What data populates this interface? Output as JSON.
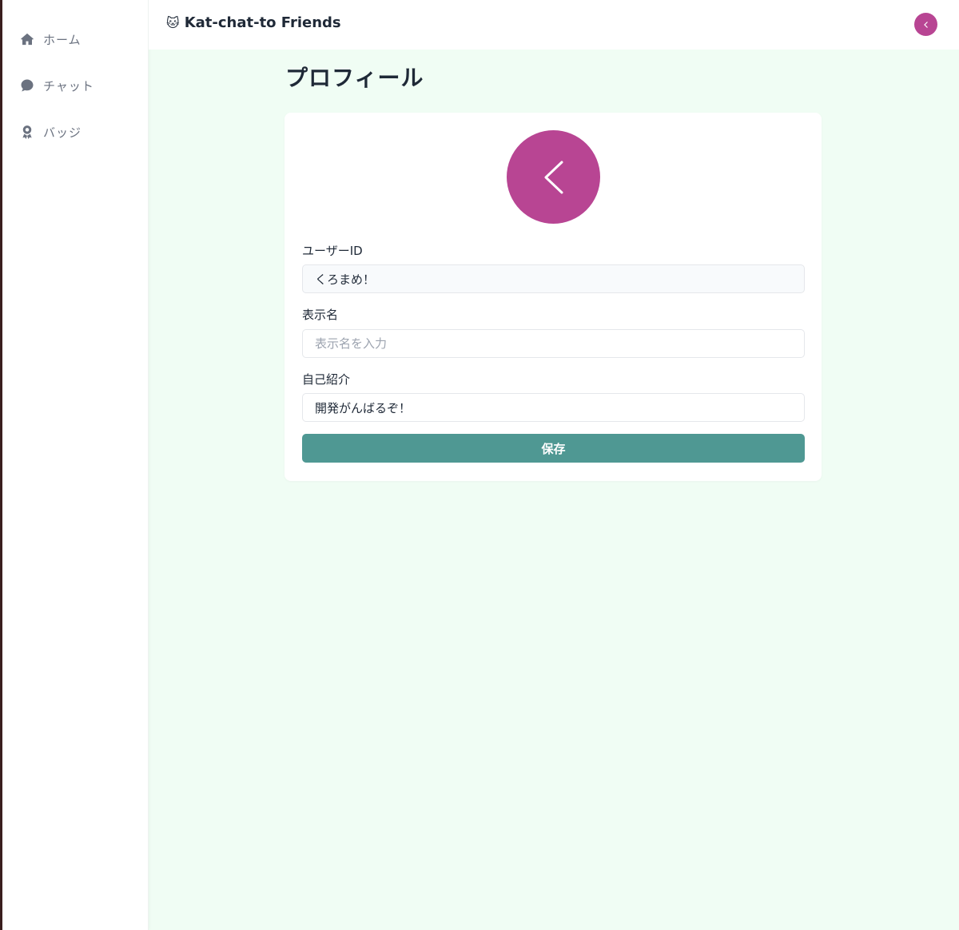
{
  "sidebar": {
    "items": [
      {
        "label": "ホーム",
        "icon": "home-icon"
      },
      {
        "label": "チャット",
        "icon": "chat-bubble-icon"
      },
      {
        "label": "バッジ",
        "icon": "badge-icon"
      }
    ]
  },
  "header": {
    "brand_emoji": "🐱",
    "brand_name": "Kat-chat-to Friends",
    "avatar_icon": "chevron-left-icon"
  },
  "page": {
    "title": "プロフィール"
  },
  "profile": {
    "avatar_icon": "chevron-left-icon",
    "user_id_label": "ユーザーID",
    "user_id_value": "くろまめ！",
    "display_name_label": "表示名",
    "display_name_placeholder": "表示名を入力",
    "display_name_value": "",
    "bio_label": "自己紹介",
    "bio_value": "開発がんばるぞ！",
    "save_label": "保存"
  },
  "colors": {
    "accent": "#b84593",
    "button": "#4f9893",
    "background": "#f0fdf4"
  }
}
